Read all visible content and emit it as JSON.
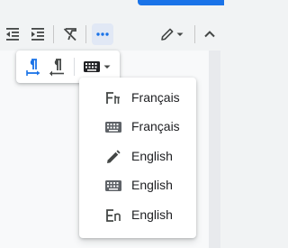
{
  "colors": {
    "accent": "#1a73e8",
    "icon": "#444746",
    "text": "#202124"
  },
  "toolbar": {
    "icons": [
      "decrease-indent-icon",
      "increase-indent-icon",
      "clear-formatting-icon",
      "more-options-icon",
      "editing-mode-pencil-icon",
      "chevron-down-icon",
      "collapse-chevron-up-icon"
    ]
  },
  "subbar": {
    "icons": [
      "ltr-paragraph-icon",
      "rtl-paragraph-icon",
      "input-tools-keyboard-icon",
      "dropdown-arrow-icon"
    ]
  },
  "input_tools_menu": {
    "items": [
      {
        "label": "Français",
        "icon": "transliteration-icon"
      },
      {
        "label": "Français",
        "icon": "keyboard-icon"
      },
      {
        "label": "English",
        "icon": "handwriting-pencil-icon"
      },
      {
        "label": "English",
        "icon": "keyboard-icon"
      },
      {
        "label": "English",
        "icon": "transliteration-icon"
      }
    ]
  }
}
